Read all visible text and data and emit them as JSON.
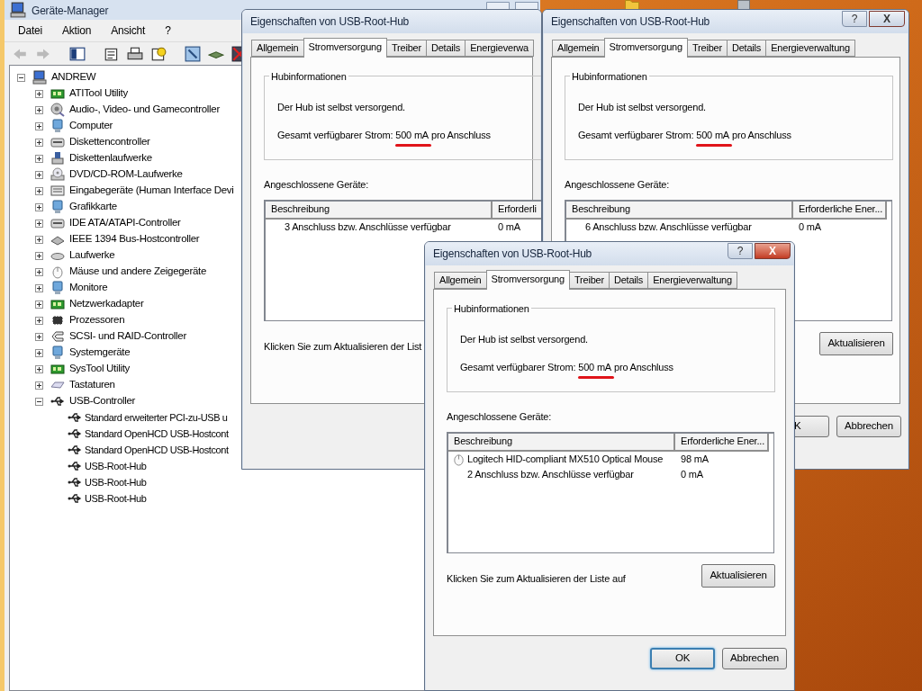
{
  "device_manager": {
    "title": "Geräte-Manager",
    "menu": [
      "Datei",
      "Aktion",
      "Ansicht",
      "?"
    ],
    "toolbar_buttons": [
      {
        "disabled": true
      },
      {
        "disabled": true
      },
      {
        "disabled": false
      },
      {
        "disabled": false
      },
      {
        "disabled": false
      },
      {
        "disabled": false
      },
      {
        "disabled": false
      },
      {
        "disabled": false
      },
      {
        "disabled": false
      }
    ],
    "tree": {
      "label": "ANDREW",
      "expanded": true,
      "children": [
        {
          "label": "ATITool Utility",
          "expanded": false
        },
        {
          "label": "Audio-, Video- und Gamecontroller",
          "expanded": false
        },
        {
          "label": "Computer",
          "expanded": false
        },
        {
          "label": "Diskettencontroller",
          "expanded": false
        },
        {
          "label": "Diskettenlaufwerke",
          "expanded": false
        },
        {
          "label": "DVD/CD-ROM-Laufwerke",
          "expanded": false
        },
        {
          "label": "Eingabegeräte (Human Interface Devi",
          "expanded": false
        },
        {
          "label": "Grafikkarte",
          "expanded": false
        },
        {
          "label": "IDE ATA/ATAPI-Controller",
          "expanded": false
        },
        {
          "label": "IEEE 1394 Bus-Hostcontroller",
          "expanded": false
        },
        {
          "label": "Laufwerke",
          "expanded": false
        },
        {
          "label": "Mäuse und andere Zeigegeräte",
          "expanded": false
        },
        {
          "label": "Monitore",
          "expanded": false
        },
        {
          "label": "Netzwerkadapter",
          "expanded": false
        },
        {
          "label": "Prozessoren",
          "expanded": false
        },
        {
          "label": "SCSI- und RAID-Controller",
          "expanded": false
        },
        {
          "label": "Systemgeräte",
          "expanded": false
        },
        {
          "label": "SysTool Utility",
          "expanded": false
        },
        {
          "label": "Tastaturen",
          "expanded": false
        },
        {
          "label": "USB-Controller",
          "expanded": true,
          "children": [
            {
              "label": "Standard erweiterter PCI-zu-USB u"
            },
            {
              "label": "Standard OpenHCD USB-Hostcont"
            },
            {
              "label": "Standard OpenHCD USB-Hostcont"
            },
            {
              "label": "USB-Root-Hub"
            },
            {
              "label": "USB-Root-Hub"
            },
            {
              "label": "USB-Root-Hub"
            }
          ]
        }
      ]
    }
  },
  "dialogs": [
    {
      "title": "Eigenschaften von USB-Root-Hub",
      "tabs": [
        {
          "label": "Allgemein",
          "selected": false
        },
        {
          "label": "Stromversorgung",
          "selected": true
        },
        {
          "label": "Treiber",
          "selected": false
        },
        {
          "label": "Details",
          "selected": false
        },
        {
          "label": "Energieverwa",
          "selected": false
        }
      ],
      "group_title": "Hubinformationen",
      "power_text": "Der Hub ist selbst versorgend.",
      "current": {
        "label": "Gesamt verfügbarer Strom:",
        "value": "500 mA",
        "suffix": "pro Anschluss",
        "underlined": true
      },
      "devices_label": "Angeschlossene Geräte:",
      "columns": [
        "Beschreibung",
        "Erforderli"
      ],
      "rows": [
        {
          "kind": "ports",
          "description": "3 Anschluss bzw. Anschlüsse verfügbar",
          "power": "0 mA"
        }
      ],
      "refresh_hint": "Klicken Sie zum Aktualisieren der List"
    },
    {
      "title": "Eigenschaften von USB-Root-Hub",
      "title_buttons": {
        "help": "?",
        "close": "X"
      },
      "tabs": [
        {
          "label": "Allgemein",
          "selected": false
        },
        {
          "label": "Stromversorgung",
          "selected": true
        },
        {
          "label": "Treiber",
          "selected": false
        },
        {
          "label": "Details",
          "selected": false
        },
        {
          "label": "Energieverwaltung",
          "selected": false
        }
      ],
      "group_title": "Hubinformationen",
      "power_text": "Der Hub ist selbst versorgend.",
      "current": {
        "label": "Gesamt verfügbarer Strom:",
        "value": "500 mA",
        "suffix": "pro Anschluss",
        "underlined": true
      },
      "devices_label": "Angeschlossene Geräte:",
      "columns": [
        "Beschreibung",
        "Erforderliche Ener..."
      ],
      "rows": [
        {
          "kind": "ports",
          "description": "6 Anschluss bzw. Anschlüsse verfügbar",
          "power": "0 mA"
        }
      ],
      "refresh_button": "Aktualisieren",
      "buttons": [
        {
          "label": "K",
          "focused": false
        },
        {
          "label": "Abbrechen",
          "focused": false
        }
      ]
    },
    {
      "title": "Eigenschaften von USB-Root-Hub",
      "title_buttons": {
        "help": "?",
        "close": "X"
      },
      "tabs": [
        {
          "label": "Allgemein",
          "selected": false
        },
        {
          "label": "Stromversorgung",
          "selected": true
        },
        {
          "label": "Treiber",
          "selected": false
        },
        {
          "label": "Details",
          "selected": false
        },
        {
          "label": "Energieverwaltung",
          "selected": false
        }
      ],
      "group_title": "Hubinformationen",
      "power_text": "Der Hub ist selbst versorgend.",
      "current": {
        "label": "Gesamt verfügbarer Strom:",
        "value": "500 mA",
        "suffix": "pro Anschluss",
        "underlined": true
      },
      "devices_label": "Angeschlossene Geräte:",
      "columns": [
        "Beschreibung",
        "Erforderliche Ener..."
      ],
      "rows": [
        {
          "kind": "device",
          "description": "Logitech HID-compliant MX510 Optical Mouse",
          "power": "98 mA"
        },
        {
          "kind": "ports",
          "description": "2 Anschluss bzw. Anschlüsse verfügbar",
          "power": "0 mA"
        }
      ],
      "refresh_hint": "Klicken Sie zum Aktualisieren der Liste auf",
      "refresh_button": "Aktualisieren",
      "buttons": [
        {
          "label": "OK",
          "focused": true
        },
        {
          "label": "Abbrechen",
          "focused": false
        }
      ]
    }
  ]
}
